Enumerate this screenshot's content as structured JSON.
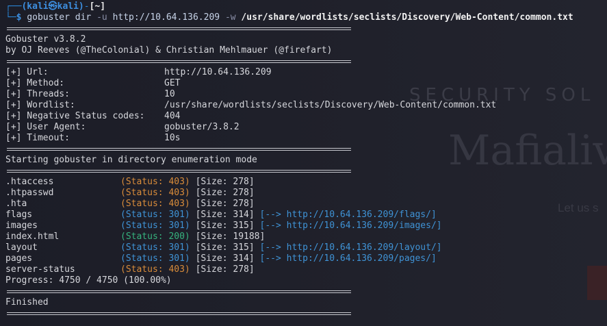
{
  "watermark": {
    "line1": "SECURITY SOL",
    "line2": "Mafialiv",
    "line3": "Let us s"
  },
  "prompt": {
    "corner": "┌──",
    "user_host": "(kali㉿kali)",
    "dash": "-",
    "dir": "[~]",
    "corner2": "└─",
    "symbol": "$",
    "command": "gobuster",
    "args1": "dir",
    "flag_u": "-u",
    "url": "http://10.64.136.209",
    "flag_w": "-w",
    "wordlist": "/usr/share/wordlists/seclists/Discovery/Web-Content/common.txt"
  },
  "banner": {
    "version": "Gobuster v3.8.2",
    "authors": "by OJ Reeves (@TheColonial) & Christian Mehlmauer (@firefart)"
  },
  "info": [
    {
      "key": "[+] Url:",
      "value": "http://10.64.136.209"
    },
    {
      "key": "[+] Method:",
      "value": "GET"
    },
    {
      "key": "[+] Threads:",
      "value": "10"
    },
    {
      "key": "[+] Wordlist:",
      "value": "/usr/share/wordlists/seclists/Discovery/Web-Content/common.txt"
    },
    {
      "key": "[+] Negative Status codes:",
      "value": "404"
    },
    {
      "key": "[+] User Agent:",
      "value": "gobuster/3.8.2"
    },
    {
      "key": "[+] Timeout:",
      "value": "10s"
    }
  ],
  "start_msg": "Starting gobuster in directory enumeration mode",
  "results": [
    {
      "path": ".htaccess",
      "status": "(Status: 403)",
      "size": "[Size: 278]",
      "redirect": ""
    },
    {
      "path": ".htpasswd",
      "status": "(Status: 403)",
      "size": "[Size: 278]",
      "redirect": ""
    },
    {
      "path": ".hta",
      "status": "(Status: 403)",
      "size": "[Size: 278]",
      "redirect": ""
    },
    {
      "path": "flags",
      "status": "(Status: 301)",
      "size": "[Size: 314]",
      "redirect": "[--> http://10.64.136.209/flags/]"
    },
    {
      "path": "images",
      "status": "(Status: 301)",
      "size": "[Size: 315]",
      "redirect": "[--> http://10.64.136.209/images/]"
    },
    {
      "path": "index.html",
      "status": "(Status: 200)",
      "size": "[Size: 19188]",
      "redirect": ""
    },
    {
      "path": "layout",
      "status": "(Status: 301)",
      "size": "[Size: 315]",
      "redirect": "[--> http://10.64.136.209/layout/]"
    },
    {
      "path": "pages",
      "status": "(Status: 301)",
      "size": "[Size: 314]",
      "redirect": "[--> http://10.64.136.209/pages/]"
    },
    {
      "path": "server-status",
      "status": "(Status: 403)",
      "size": "[Size: 278]",
      "redirect": ""
    }
  ],
  "progress": "Progress: 4750 / 4750 (100.00%)",
  "finished": "Finished",
  "colors": {
    "status_403": "#d98c3a",
    "status_301": "#3f93d6",
    "status_200": "#36b37e",
    "prompt": "#2a86d6",
    "background": "#1e1f29"
  }
}
